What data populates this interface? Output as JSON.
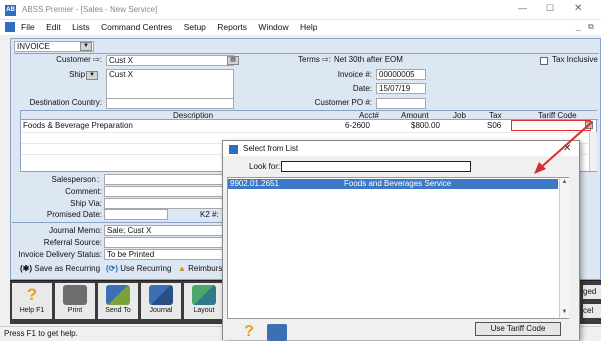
{
  "window": {
    "title": "ABSS Premier - [Sales - New Service]",
    "icon_label": "AB",
    "controls": [
      "—",
      "☐",
      "✕"
    ],
    "mdi_controls": [
      "_",
      "⧉"
    ]
  },
  "menu": [
    "File",
    "Edit",
    "Lists",
    "Command Centres",
    "Setup",
    "Reports",
    "Window",
    "Help"
  ],
  "form": {
    "type_value": "INVOICE",
    "customer_label": "Customer ⇨:",
    "customer_value": "Cust X",
    "terms_label": "Terms ⇨:",
    "terms_value": "Net 30th after EOM",
    "tax_inclusive_label": "Tax Inclusive",
    "ship_to_label": "Ship to",
    "ship_to_value": "Cust X",
    "invoice_no_label": "Invoice #:",
    "invoice_no_value": "00000005",
    "date_label": "Date:",
    "date_value": "15/07/19",
    "dest_country_label": "Destination Country:",
    "customer_po_label": "Customer PO #:",
    "salesperson_label": "Salesperson",
    "comment_label": "Comment:",
    "ship_via_label": "Ship Via:",
    "promised_date_label": "Promised Date:",
    "k2_label": "K2 #:",
    "journal_memo_label": "Journal Memo:",
    "journal_memo_value": "Sale; Cust X",
    "referral_label": "Referral Source:",
    "delivery_label": "Invoice Delivery Status:",
    "delivery_value": "To be Printed"
  },
  "grid": {
    "headers": [
      "Description",
      "Acct#",
      "Amount",
      "Job",
      "Tax",
      "Tariff Code"
    ],
    "rows": [
      {
        "description": "Foods & Beverage Preparation",
        "acct": "6-2600",
        "amount": "$800.00",
        "job": "",
        "tax": "S06",
        "tariff": ""
      }
    ]
  },
  "recurring": {
    "save": "Save as Recurring",
    "use": "Use Recurring",
    "reimburse": "Reimburs"
  },
  "toolbar": {
    "help": "Help F1",
    "print": "Print",
    "send": "Send To",
    "journal": "Journal",
    "layout": "Layout",
    "right_top": "ged",
    "right_bottom": "cel"
  },
  "status_bar": "Press F1 to get help.",
  "dialog": {
    "title": "Select from List",
    "look_for_label": "Look for:",
    "look_for_value": "",
    "items": [
      {
        "code": "9902.01.2651",
        "name": "Foods and Beverages Service"
      }
    ],
    "use_button": "Use Tariff Code",
    "close": "✕"
  },
  "colors": {
    "accent_blue": "#3d78c5",
    "form_panel": "#dde6f3",
    "selection": "#3d78c5",
    "arrow_red": "#d62e2e",
    "tariff_field_border": "#e03030"
  }
}
